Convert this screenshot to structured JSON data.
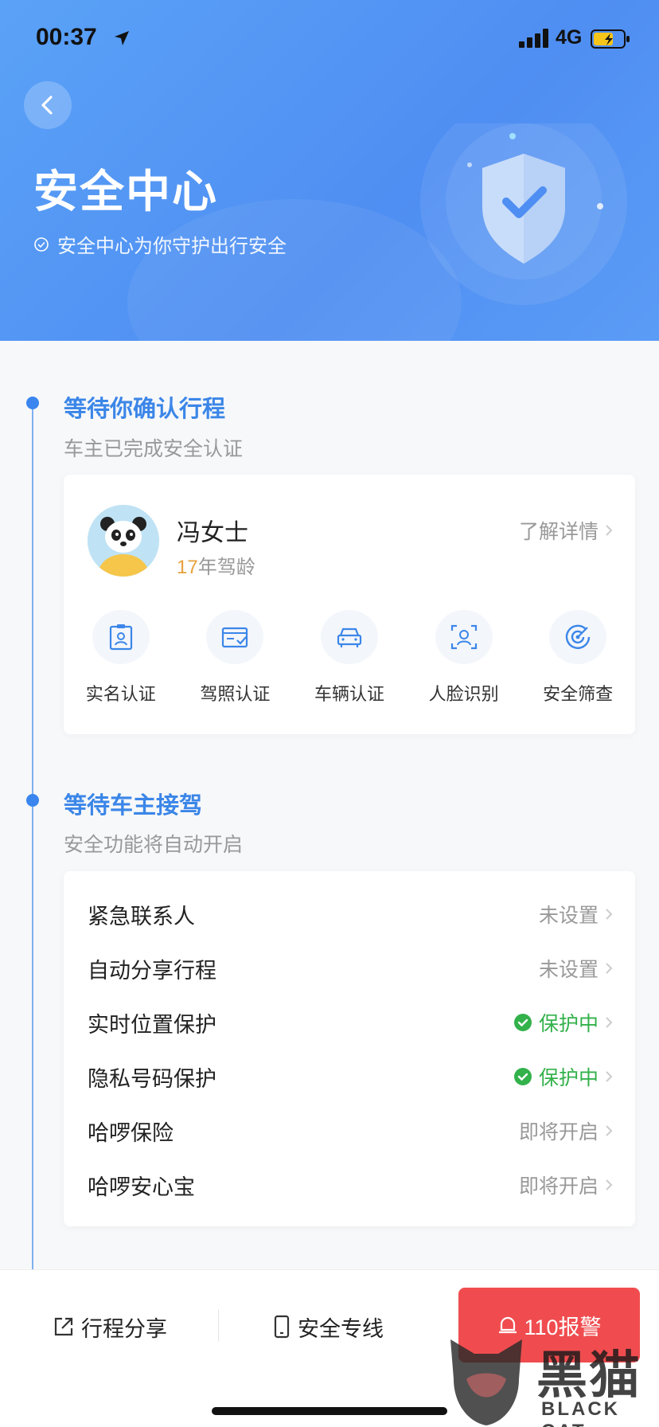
{
  "status_bar": {
    "time": "00:37",
    "network": "4G"
  },
  "header": {
    "title": "安全中心",
    "subtitle": "安全中心为你守护出行安全"
  },
  "section1": {
    "title": "等待你确认行程",
    "subtitle": "车主已完成安全认证"
  },
  "driver": {
    "name": "冯女士",
    "years_num": "17",
    "years_suffix": "年驾龄",
    "details_label": "了解详情"
  },
  "verifications": [
    {
      "label": "实名认证",
      "icon": "id-card-icon"
    },
    {
      "label": "驾照认证",
      "icon": "license-icon"
    },
    {
      "label": "车辆认证",
      "icon": "car-icon"
    },
    {
      "label": "人脸识别",
      "icon": "face-scan-icon"
    },
    {
      "label": "安全筛查",
      "icon": "radar-icon"
    }
  ],
  "section2": {
    "title": "等待车主接驾",
    "subtitle": "安全功能将自动开启"
  },
  "features": [
    {
      "label": "紧急联系人",
      "status": "未设置",
      "active": false
    },
    {
      "label": "自动分享行程",
      "status": "未设置",
      "active": false
    },
    {
      "label": "实时位置保护",
      "status": "保护中",
      "active": true
    },
    {
      "label": "隐私号码保护",
      "status": "保护中",
      "active": true
    },
    {
      "label": "哈啰保险",
      "status": "即将开启",
      "active": false
    },
    {
      "label": "哈啰安心宝",
      "status": "即将开启",
      "active": false
    }
  ],
  "bottom_bar": {
    "share_label": "行程分享",
    "hotline_label": "安全专线",
    "alarm_label": "110报警"
  },
  "watermark": {
    "text": "黑猫",
    "sub": "BLACK CAT"
  },
  "colors": {
    "accent": "#3b86e8",
    "active": "#33b14b",
    "alarm": "#f04c4f",
    "header": "#5a9cf5"
  }
}
